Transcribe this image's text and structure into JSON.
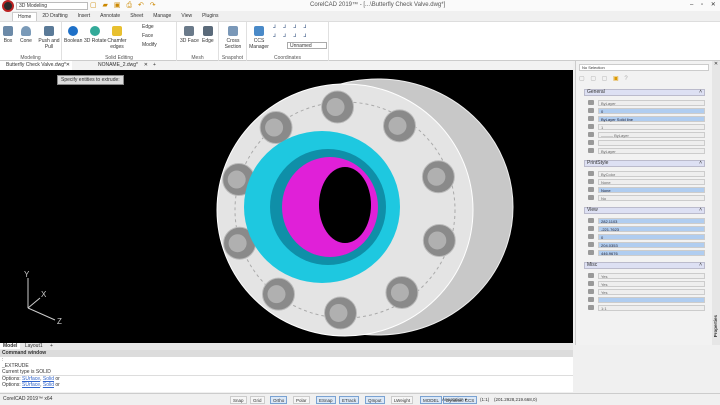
{
  "app": {
    "workspace": "3D Modeling",
    "title": "CorelCAD 2019™ - [...\\Butterfly Check Valve.dwg*]"
  },
  "menu_tabs": [
    "Home",
    "2D Drafting",
    "Insert",
    "Annotate",
    "Sheet",
    "Manage",
    "View",
    "Plugins"
  ],
  "ribbon": {
    "modeling": {
      "label": "Modeling",
      "buttons": [
        "Box",
        "Cone",
        "Push and Pull"
      ]
    },
    "solid_editing": {
      "label": "Solid Editing",
      "buttons": [
        "Boolean",
        "3D Rotate",
        "Chamfer edges"
      ],
      "small": [
        "Edge",
        "Face",
        "Modify"
      ]
    },
    "mesh": {
      "label": "Mesh",
      "buttons": [
        "3D Face",
        "Edge"
      ]
    },
    "snapshot": {
      "label": "Snapshot",
      "buttons": [
        "Cross Section"
      ]
    },
    "coordinates": {
      "label": "Coordinates",
      "buttons": [
        "CCS Manager"
      ],
      "ccs_value": "Unnamed"
    }
  },
  "doc_tabs": [
    "Butterfly Check Valve.dwg*",
    "NONAME_2.dwg*"
  ],
  "tooltip": "Specify entities to extrude:",
  "axis": {
    "x": "X",
    "y": "Y",
    "z": "Z"
  },
  "properties": {
    "selection": "No Selection",
    "general": {
      "title": "General",
      "fields": [
        "ByLayer",
        "0",
        "ByLayer    Solid line",
        "1",
        "——— ByLayer",
        "",
        "ByLayer"
      ]
    },
    "printstyle": {
      "title": "PrintStyle",
      "fields": [
        "ByColor",
        "None",
        "None",
        "No"
      ]
    },
    "view": {
      "title": "View",
      "fields": [
        "282.1103",
        "-221.7623",
        "0",
        "204.0353",
        "446.9676"
      ]
    },
    "misc": {
      "title": "Misc",
      "fields": [
        "Yes",
        "Yes",
        "Yes",
        "",
        "1:1"
      ]
    },
    "side_label": "Properties"
  },
  "model_tabs": [
    "Model",
    "Layout1"
  ],
  "command": {
    "title": "Command window",
    "lines": [
      ":",
      "_EXTRUDE",
      "Current type is SOLID"
    ],
    "options": [
      {
        "prefix": "Options:",
        "a": "SUrface",
        "b": "Solid",
        "suffix": "or"
      },
      {
        "prefix": "Options:",
        "a": "SUrface",
        "b": "Solid",
        "suffix": "or"
      }
    ]
  },
  "status": {
    "app": "CorelCAD 2019™ x64",
    "toggles": [
      {
        "label": "Snap",
        "on": false
      },
      {
        "label": "Grid",
        "on": false
      },
      {
        "label": "Ortho",
        "on": true
      },
      {
        "label": "Polar",
        "on": false
      },
      {
        "label": "ESnap",
        "on": true
      },
      {
        "label": "ETrack",
        "on": true
      },
      {
        "label": "QInput",
        "on": true
      },
      {
        "label": "LWeight",
        "on": false
      },
      {
        "label": "MODEL",
        "on": true
      },
      {
        "label": "Dynamic CCS",
        "on": true
      }
    ],
    "annotation": "Annotation",
    "scale": "(1:1)",
    "coords": "(201.2928,219.668,0)"
  },
  "colors": {
    "cyan": "#1ec8e0",
    "magenta": "#e020d8",
    "viewport": "#000000"
  }
}
